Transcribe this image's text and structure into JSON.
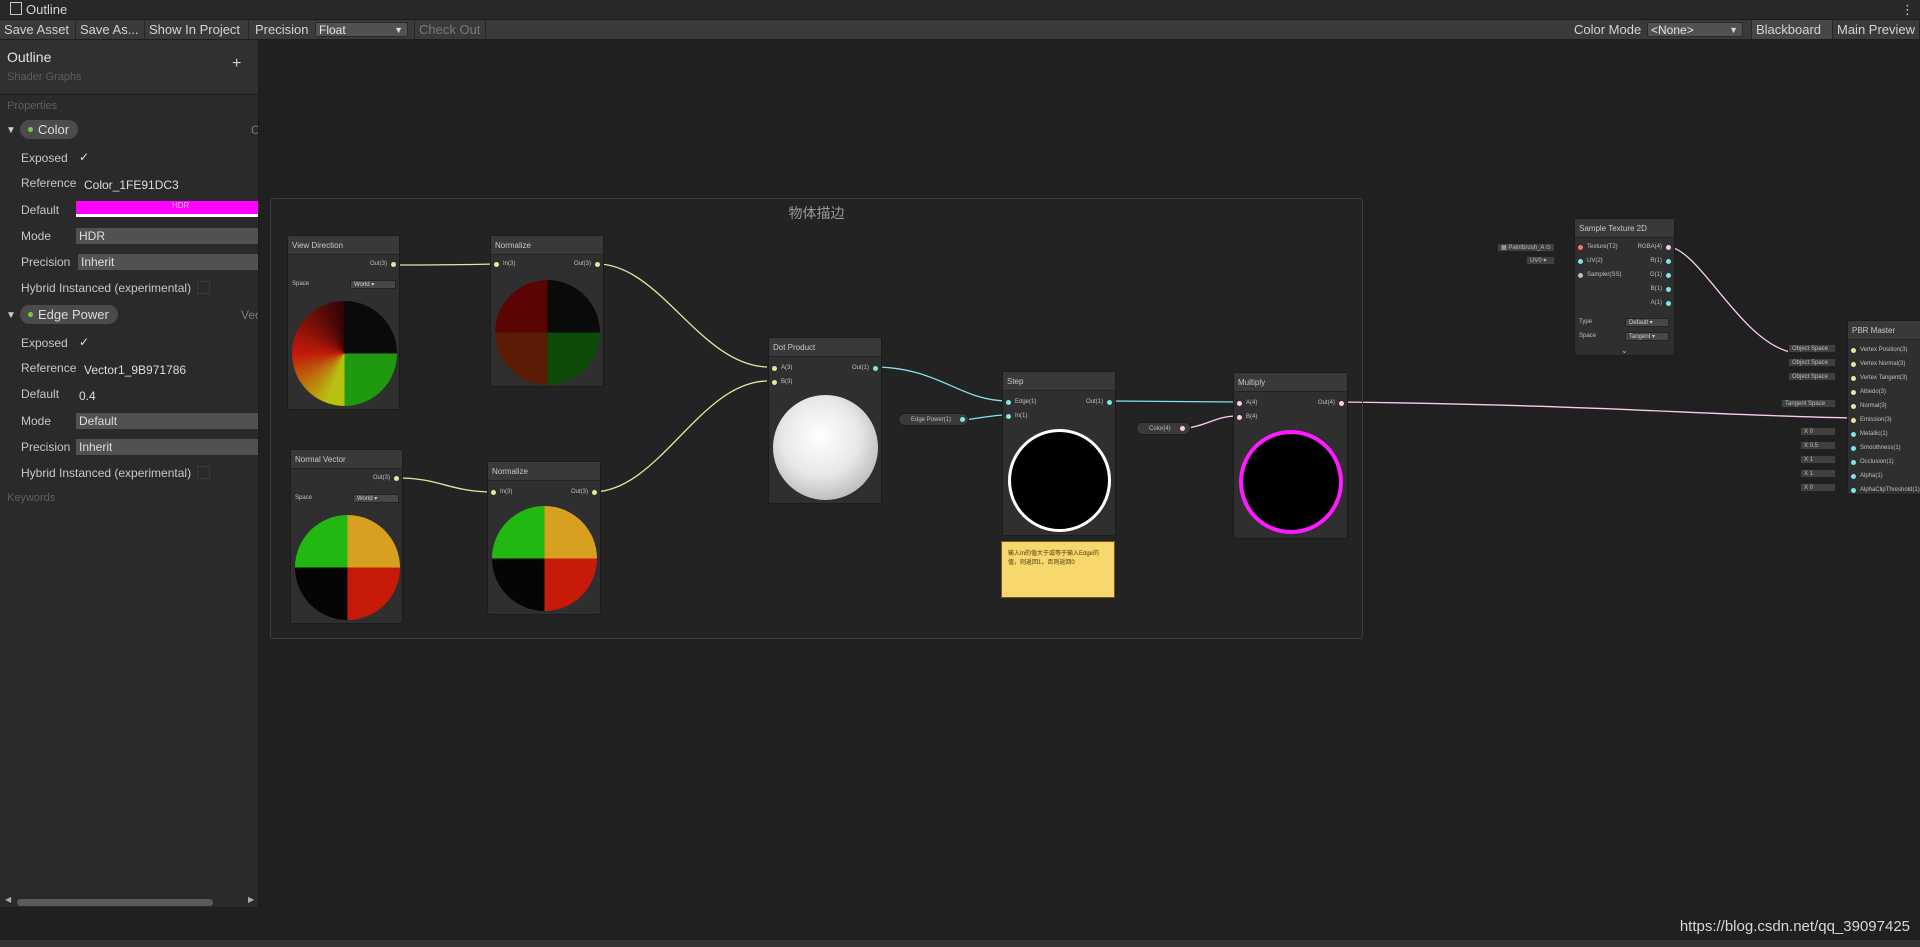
{
  "window": {
    "title": "Outline"
  },
  "toolbar": {
    "save_asset": "Save Asset",
    "save_as": "Save As...",
    "show_in_project": "Show In Project",
    "precision_label": "Precision",
    "precision_value": "Float",
    "check_out": "Check Out",
    "color_mode_label": "Color Mode",
    "color_mode_value": "<None>",
    "blackboard": "Blackboard",
    "main_preview": "Main Preview"
  },
  "blackboard": {
    "title": "Outline",
    "subtitle": "Shader Graphs",
    "add": "+",
    "properties_label": "Properties",
    "keywords_label": "Keywords",
    "props": [
      {
        "name": "Color",
        "type_cut": "C",
        "exposed_label": "Exposed",
        "reference_label": "Reference",
        "reference": "Color_1FE91DC3",
        "default_label": "Default",
        "default_color": "#ff00ff",
        "default_text": "HDR",
        "mode_label": "Mode",
        "mode": "HDR",
        "precision_label": "Precision",
        "precision": "Inherit",
        "hybrid_label": "Hybrid Instanced (experimental)"
      },
      {
        "name": "Edge Power",
        "type_cut": "Vec",
        "exposed_label": "Exposed",
        "reference_label": "Reference",
        "reference": "Vector1_9B971786",
        "default_label": "Default",
        "default": "0.4",
        "mode_label": "Mode",
        "mode": "Default",
        "precision_label": "Precision",
        "precision": "Inherit",
        "hybrid_label": "Hybrid Instanced (experimental)"
      }
    ]
  },
  "graph": {
    "group_title": "物体描边",
    "sticky_note": "输入In的值大于或等于输入Edge的值，则返回1，否则返回0",
    "nodes": {
      "view_direction": {
        "title": "View Direction",
        "out": "Out(3)",
        "space_label": "Space",
        "space": "World"
      },
      "normalize1": {
        "title": "Normalize",
        "in": "In(3)",
        "out": "Out(3)"
      },
      "normal_vector": {
        "title": "Normal Vector",
        "out": "Out(3)",
        "space_label": "Space",
        "space": "World"
      },
      "normalize2": {
        "title": "Normalize",
        "in": "In(3)",
        "out": "Out(3)"
      },
      "dot_product": {
        "title": "Dot Product",
        "a": "A(3)",
        "b": "B(3)",
        "out": "Out(1)"
      },
      "edge_power": {
        "label": "Edge Power(1)"
      },
      "step": {
        "title": "Step",
        "edge": "Edge(1)",
        "in": "In(1)",
        "out": "Out(1)"
      },
      "color_prop": {
        "label": "Color(4)"
      },
      "multiply": {
        "title": "Multiply",
        "a": "A(4)",
        "b": "B(4)",
        "out": "Out(4)"
      },
      "sample_texture": {
        "title": "Sample Texture 2D",
        "inputs": [
          "Texture(T2)",
          "UV(2)",
          "Sampler(SS)"
        ],
        "outputs": [
          "RGBA(4)",
          "R(1)",
          "G(1)",
          "B(1)",
          "A(1)"
        ],
        "tex_input": "Paintbrush_A",
        "uv_input": "UV0",
        "type_label": "Type",
        "type": "Default",
        "space_label": "Space",
        "space": "Tangent"
      },
      "pbr_master": {
        "title": "PBR Master",
        "ports": [
          "Vertex Position(3)",
          "Vertex Normal(3)",
          "Vertex Tangent(3)",
          "Albedo(3)",
          "Normal(3)",
          "Emission(3)",
          "Metallic(1)",
          "Smoothness(1)",
          "Occlusion(1)",
          "Alpha(1)",
          "AlphaClipThreshold(1)"
        ],
        "space_inputs": [
          "Object Space",
          "Object Space",
          "Object Space",
          "Tangent Space"
        ],
        "value_inputs": [
          {
            "axis": "X",
            "value": "0"
          },
          {
            "axis": "X",
            "value": "0.5"
          },
          {
            "axis": "X",
            "value": "1"
          },
          {
            "axis": "X",
            "value": "1"
          },
          {
            "axis": "X",
            "value": "0"
          }
        ]
      }
    }
  },
  "watermark": "https://blog.csdn.net/qq_39097425",
  "colors": {
    "accent_magenta": "#ff00ff",
    "wire_vec3": "#e6e6a0",
    "wire_vec1": "#84e4e7",
    "wire_vec4": "#fbcbf4",
    "sticky": "#f8d76d"
  }
}
